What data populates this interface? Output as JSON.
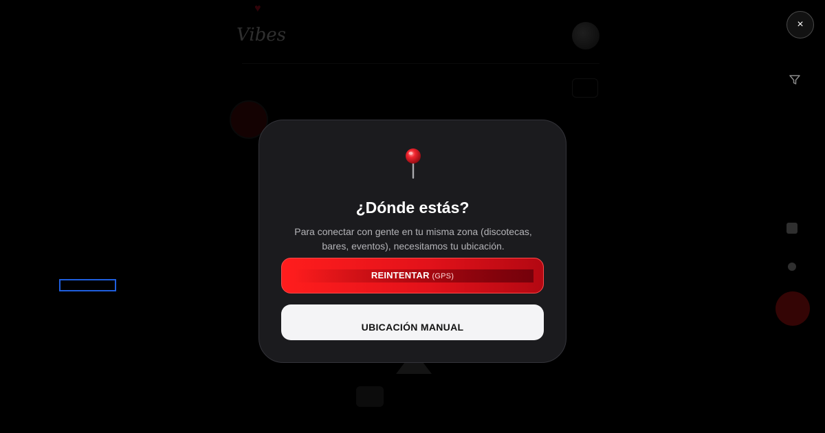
{
  "close_button": {
    "label": "×",
    "icon": "close-icon"
  },
  "modal": {
    "icon": "map-pin-icon",
    "title": "¿Dónde estás?",
    "description": "Para conectar con gente en tu misma zona (discotecas, bares, eventos), necesitamos tu ubicación.",
    "retry_button": {
      "label": "REINTENTAR",
      "sublabel": "(GPS)"
    },
    "manual_button": {
      "label": "UBICACIÓN MANUAL"
    }
  },
  "colors": {
    "background": "#000000",
    "modal_background": "#1b1b1e",
    "accent_red": "#ff1d1d",
    "manual_button_bg": "#f4f4f6",
    "focus_outline": "#1f5fe0"
  }
}
